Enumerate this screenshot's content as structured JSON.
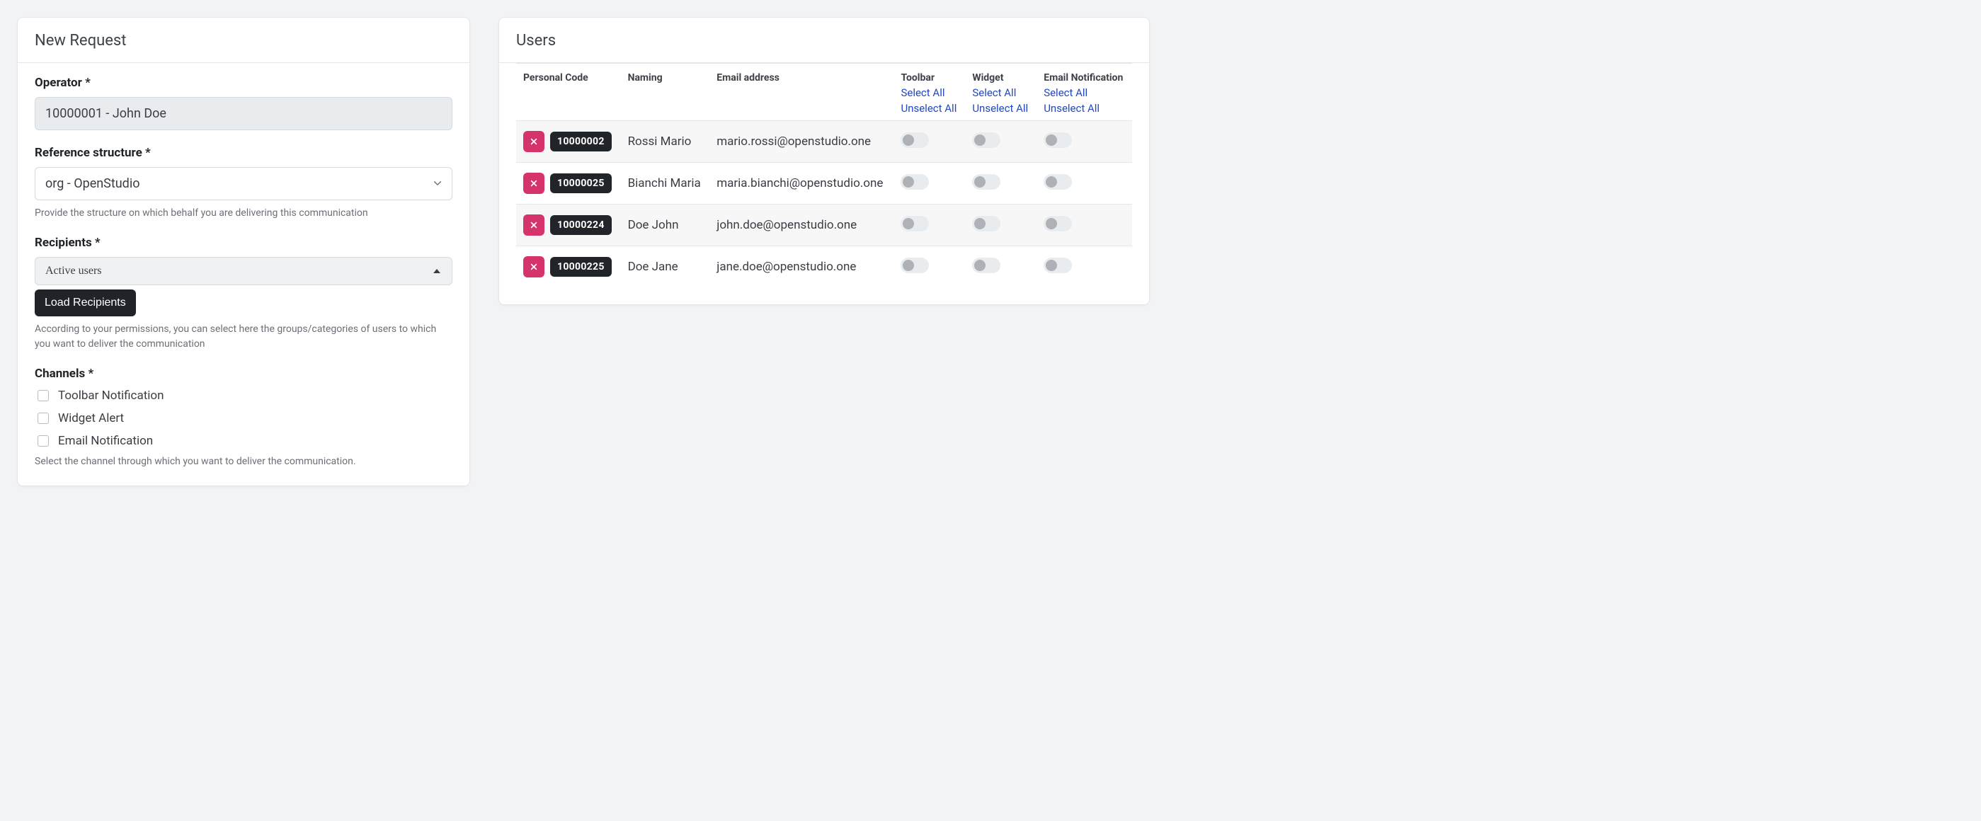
{
  "left_card": {
    "title": "New Request",
    "operator": {
      "label": "Operator *",
      "value": "10000001 - John Doe"
    },
    "structure": {
      "label": "Reference structure *",
      "value": "org - OpenStudio",
      "help": "Provide the structure on which behalf you are delivering this communication"
    },
    "recipients": {
      "label": "Recipients *",
      "selected": "Active users",
      "load_button": "Load Recipients",
      "help": "According to your permissions, you can select here the groups/categories of users to which you want to deliver the communication"
    },
    "channels": {
      "label": "Channels *",
      "options": [
        "Toolbar Notification",
        "Widget Alert",
        "Email Notification"
      ],
      "help": "Select the channel through which you want to deliver the communication."
    }
  },
  "right_card": {
    "title": "Users",
    "columns": {
      "code": "Personal Code",
      "naming": "Naming",
      "email": "Email address",
      "toolbar": "Toolbar",
      "widget": "Widget",
      "emailnotif": "Email Notification"
    },
    "links": {
      "select_all": "Select All",
      "unselect_all": "Unselect All"
    },
    "rows": [
      {
        "code": "10000002",
        "naming": "Rossi Mario",
        "email": "mario.rossi@openstudio.one"
      },
      {
        "code": "10000025",
        "naming": "Bianchi Maria",
        "email": "maria.bianchi@openstudio.one"
      },
      {
        "code": "10000224",
        "naming": "Doe John",
        "email": "john.doe@openstudio.one"
      },
      {
        "code": "10000225",
        "naming": "Doe Jane",
        "email": "jane.doe@openstudio.one"
      }
    ]
  }
}
